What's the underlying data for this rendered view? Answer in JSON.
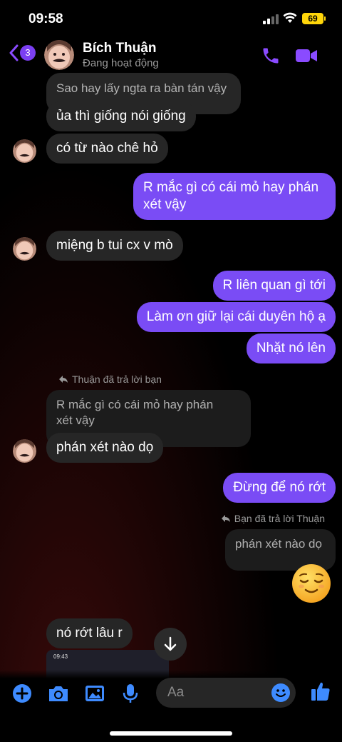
{
  "status_bar": {
    "time": "09:58",
    "battery": "69"
  },
  "header": {
    "back_badge": "3",
    "name": "Bích Thuận",
    "presence": "Đang hoạt động"
  },
  "messages": {
    "m1": "Sao hay lấy ngta ra bàn tán vậy",
    "m2": "ủa thì giống nói giống",
    "m3": "có từ nào chê hỏ",
    "m4_line1": "R mắc gì có cái mỏ hay phán",
    "m4_line2": "xét vậy",
    "m5": "miệng b tui cx v mò",
    "m6": "R liên quan gì tới",
    "m7": "Làm ơn giữ lại cái duyên hộ ạ",
    "m8": "Nhặt nó lên",
    "reply1_label": "Thuận đã trả lời bạn",
    "reply1_quote_line1": "R mắc gì có cái mỏ hay phán",
    "reply1_quote_line2": "xét vậy",
    "m9": "phán xét nào dọ",
    "m10": "Đừng để nó rớt",
    "reply2_label": "Bạn đã trả lời Thuận",
    "reply2_quote": "phán xét nào dọ",
    "m11": "nó rớt lâu r",
    "thumb_time": "09:43"
  },
  "composer": {
    "placeholder": "Aa"
  },
  "colors": {
    "accent": "#7a4cf5",
    "incoming": "#262626",
    "icon_blue": "#3e8bff"
  }
}
